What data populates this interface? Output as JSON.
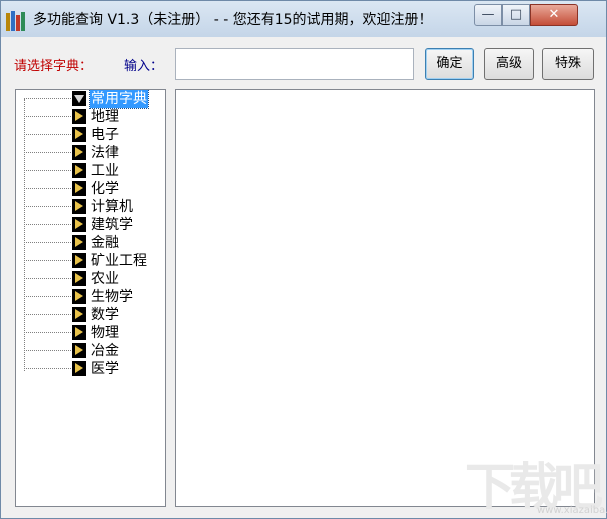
{
  "window": {
    "title": "多功能查询 V1.3（未注册）  - - 您还有15的试用期，欢迎注册！",
    "minimize_label": "—",
    "maximize_label": "□",
    "close_label": "✕"
  },
  "toolbar": {
    "dict_label": "请选择字典：",
    "input_label": "输入：",
    "input_value": "",
    "ok_label": "确定",
    "advanced_label": "高级",
    "special_label": "特殊"
  },
  "tree": {
    "items": [
      {
        "label": "常用字典",
        "selected": true
      },
      {
        "label": "地理"
      },
      {
        "label": "电子"
      },
      {
        "label": "法律"
      },
      {
        "label": "工业"
      },
      {
        "label": "化学"
      },
      {
        "label": "计算机"
      },
      {
        "label": "建筑学"
      },
      {
        "label": "金融"
      },
      {
        "label": "矿业工程"
      },
      {
        "label": "农业"
      },
      {
        "label": "生物学"
      },
      {
        "label": "数学"
      },
      {
        "label": "物理"
      },
      {
        "label": "冶金"
      },
      {
        "label": "医学"
      }
    ]
  },
  "watermark": {
    "text": "下载吧",
    "url": "www.xiazaiba.com"
  },
  "colors": {
    "dict_label": "#c00000",
    "input_label": "#00008b",
    "selection": "#3399ff"
  }
}
